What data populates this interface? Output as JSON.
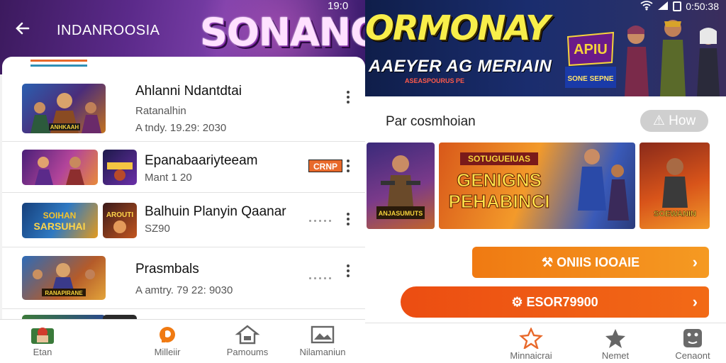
{
  "left": {
    "title": "INDANROOSIA",
    "time": "19:0",
    "brand": "SONANO",
    "rows": [
      {
        "title": "Ahlanni Ndantdtai",
        "subtitle": "Ratanalhin",
        "date": "A tndy. 19.29: 2030"
      },
      {
        "title": "Epanabaariyteeam",
        "subtitle": "Mant 1 20",
        "badge": "CRNP"
      },
      {
        "title": "Balhuin Planyin Qaanar",
        "subtitle": "SZ90"
      },
      {
        "title": "Prasmbals",
        "date": "A amtry. 79 22: 9030"
      }
    ],
    "thumb_text": {
      "row1": "ANHKAAH",
      "row3a": "SARSUHAI",
      "row3b": "AROUTI",
      "row4": "RANAPIRANE"
    },
    "nav": [
      {
        "label": "Etan",
        "icon": "game-icon"
      },
      {
        "label": "Milleiir",
        "icon": "letter-p-icon"
      },
      {
        "label": "Pamoums",
        "icon": "house-icon"
      },
      {
        "label": "Nilamaniun",
        "icon": "image-icon"
      }
    ]
  },
  "right": {
    "status_time": "0:50:38",
    "brand": "ORMONAY",
    "hero_subtitle": "AAEYER AG MERIAIN",
    "hero_small": "ASEASPOURUS PE",
    "logo_badge": "APIU",
    "logo_badge_sub": "SONE SEPNE",
    "section_title": "Par cosmhoian",
    "how_label": "How",
    "banners": [
      {
        "caption": "ANJASUMUTS"
      },
      {
        "small": "SOTUGUEIUAS",
        "line1": "GENIGNS",
        "line2": "PEHABINCI"
      },
      {
        "caption": "SOEWANIN"
      }
    ],
    "btn1": "ONIIS IOOAIE",
    "btn2": "ESOR79900",
    "nav": [
      {
        "label": "Minnaicrai",
        "icon": "star-swirl-icon"
      },
      {
        "label": "Nemet",
        "icon": "star-icon"
      },
      {
        "label": "Cenaont",
        "icon": "dice-icon"
      }
    ]
  },
  "colors": {
    "accent_orange": "#f07a12",
    "accent_red": "#ec4d12",
    "hero_purple": "#5b2a8a",
    "hero_navy": "#1a2d6e"
  }
}
